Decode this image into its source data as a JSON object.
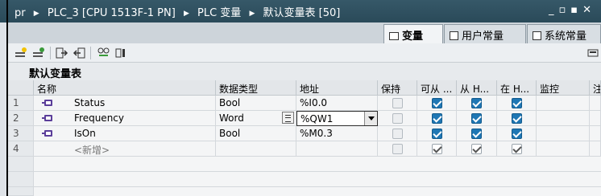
{
  "breadcrumb": [
    "pr",
    "PLC_3 [CPU 1513F-1 PN]",
    "PLC 变量",
    "默认变量表 [50]"
  ],
  "window_controls": [
    "_",
    "▫",
    "▪",
    "✕"
  ],
  "tabs": [
    {
      "label": "变量",
      "icon": "tag-table-icon",
      "active": true
    },
    {
      "label": "用户常量",
      "icon": "constant-icon",
      "active": false
    },
    {
      "label": "系统常量",
      "icon": "system-constant-icon",
      "active": false
    }
  ],
  "toolbar": {
    "icons": [
      "add-tag-icon",
      "insert-row-icon",
      "import-icon",
      "export-icon",
      "monitor-icon",
      "properties-icon"
    ]
  },
  "table": {
    "title": "默认变量表",
    "headers": [
      "名称",
      "数据类型",
      "地址",
      "保持",
      "可从 ...",
      "从 H...",
      "在 H...",
      "监控",
      "注"
    ],
    "rows": [
      {
        "num": "1",
        "name": "Status",
        "type": "Bool",
        "address": "%I0.0",
        "retain": false,
        "accessible": true,
        "writable": true,
        "visible": true
      },
      {
        "num": "2",
        "name": "Frequency",
        "type": "Word",
        "address": "%QW1",
        "retain": false,
        "accessible": true,
        "writable": true,
        "visible": true
      },
      {
        "num": "3",
        "name": "IsOn",
        "type": "Bool",
        "address": "%M0.3",
        "retain": false,
        "accessible": true,
        "writable": true,
        "visible": true
      },
      {
        "num": "4",
        "name": "<新增>",
        "type": "",
        "address": "",
        "retain": false,
        "accessible": true,
        "writable": true,
        "visible": true
      }
    ]
  },
  "colors": {
    "titlebar": "#365868",
    "checked": "#1f77b4"
  }
}
